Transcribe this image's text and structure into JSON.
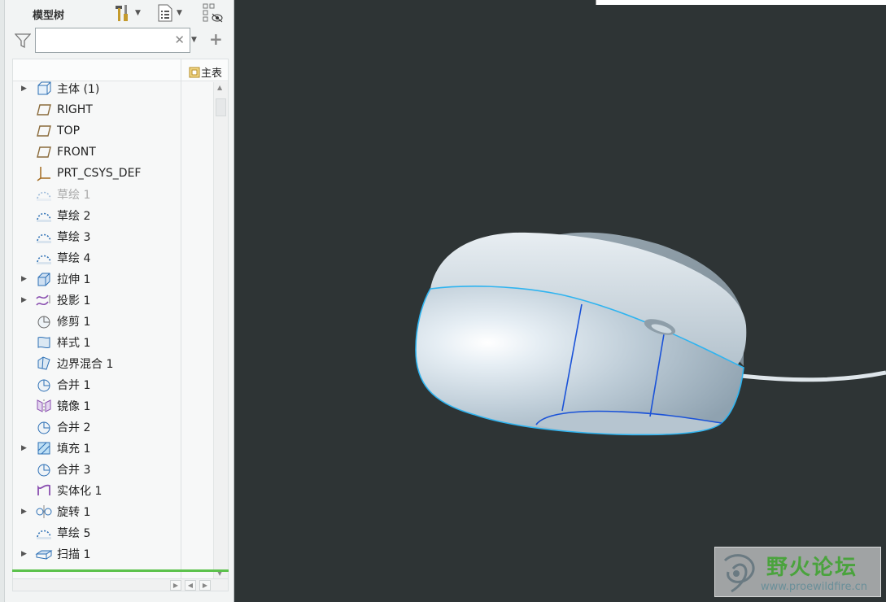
{
  "panel": {
    "title": "模型树",
    "search": {
      "value": "",
      "placeholder": ""
    },
    "column_header": "主表"
  },
  "tree": {
    "items": [
      {
        "label": "主体 (1)",
        "icon": "body-icon",
        "expandable": true
      },
      {
        "label": "RIGHT",
        "icon": "datum-plane-icon",
        "expandable": false
      },
      {
        "label": "TOP",
        "icon": "datum-plane-icon",
        "expandable": false
      },
      {
        "label": "FRONT",
        "icon": "datum-plane-icon",
        "expandable": false
      },
      {
        "label": "PRT_CSYS_DEF",
        "icon": "csys-icon",
        "expandable": false
      },
      {
        "label": "草绘 1",
        "icon": "sketch-icon",
        "expandable": false,
        "suppressed": true
      },
      {
        "label": "草绘 2",
        "icon": "sketch-icon",
        "expandable": false
      },
      {
        "label": "草绘 3",
        "icon": "sketch-icon",
        "expandable": false
      },
      {
        "label": "草绘 4",
        "icon": "sketch-icon",
        "expandable": false
      },
      {
        "label": "拉伸 1",
        "icon": "extrude-icon",
        "expandable": true
      },
      {
        "label": "投影 1",
        "icon": "project-icon",
        "expandable": true
      },
      {
        "label": "修剪 1",
        "icon": "trim-icon",
        "expandable": false
      },
      {
        "label": "样式 1",
        "icon": "style-icon",
        "expandable": false
      },
      {
        "label": "边界混合 1",
        "icon": "boundary-blend-icon",
        "expandable": false
      },
      {
        "label": "合并 1",
        "icon": "merge-icon",
        "expandable": false
      },
      {
        "label": "镜像 1",
        "icon": "mirror-icon",
        "expandable": false
      },
      {
        "label": "合并 2",
        "icon": "merge-icon",
        "expandable": false
      },
      {
        "label": "填充 1",
        "icon": "fill-icon",
        "expandable": true
      },
      {
        "label": "合并 3",
        "icon": "merge-icon",
        "expandable": false
      },
      {
        "label": "实体化 1",
        "icon": "solidify-icon",
        "expandable": false
      },
      {
        "label": "旋转 1",
        "icon": "revolve-icon",
        "expandable": true
      },
      {
        "label": "草绘 5",
        "icon": "sketch-icon",
        "expandable": false
      },
      {
        "label": "扫描 1",
        "icon": "sweep-icon",
        "expandable": true
      }
    ]
  },
  "watermark": {
    "name": "野火论坛",
    "url": "www.proewildfire.cn"
  },
  "colors": {
    "viewport_bg": "#2e3435",
    "model_surface": "#c9d6df",
    "edge_highlight": "#2fb4f0",
    "edge_inner": "#1a52d8",
    "accent_green": "#5cc24c"
  }
}
